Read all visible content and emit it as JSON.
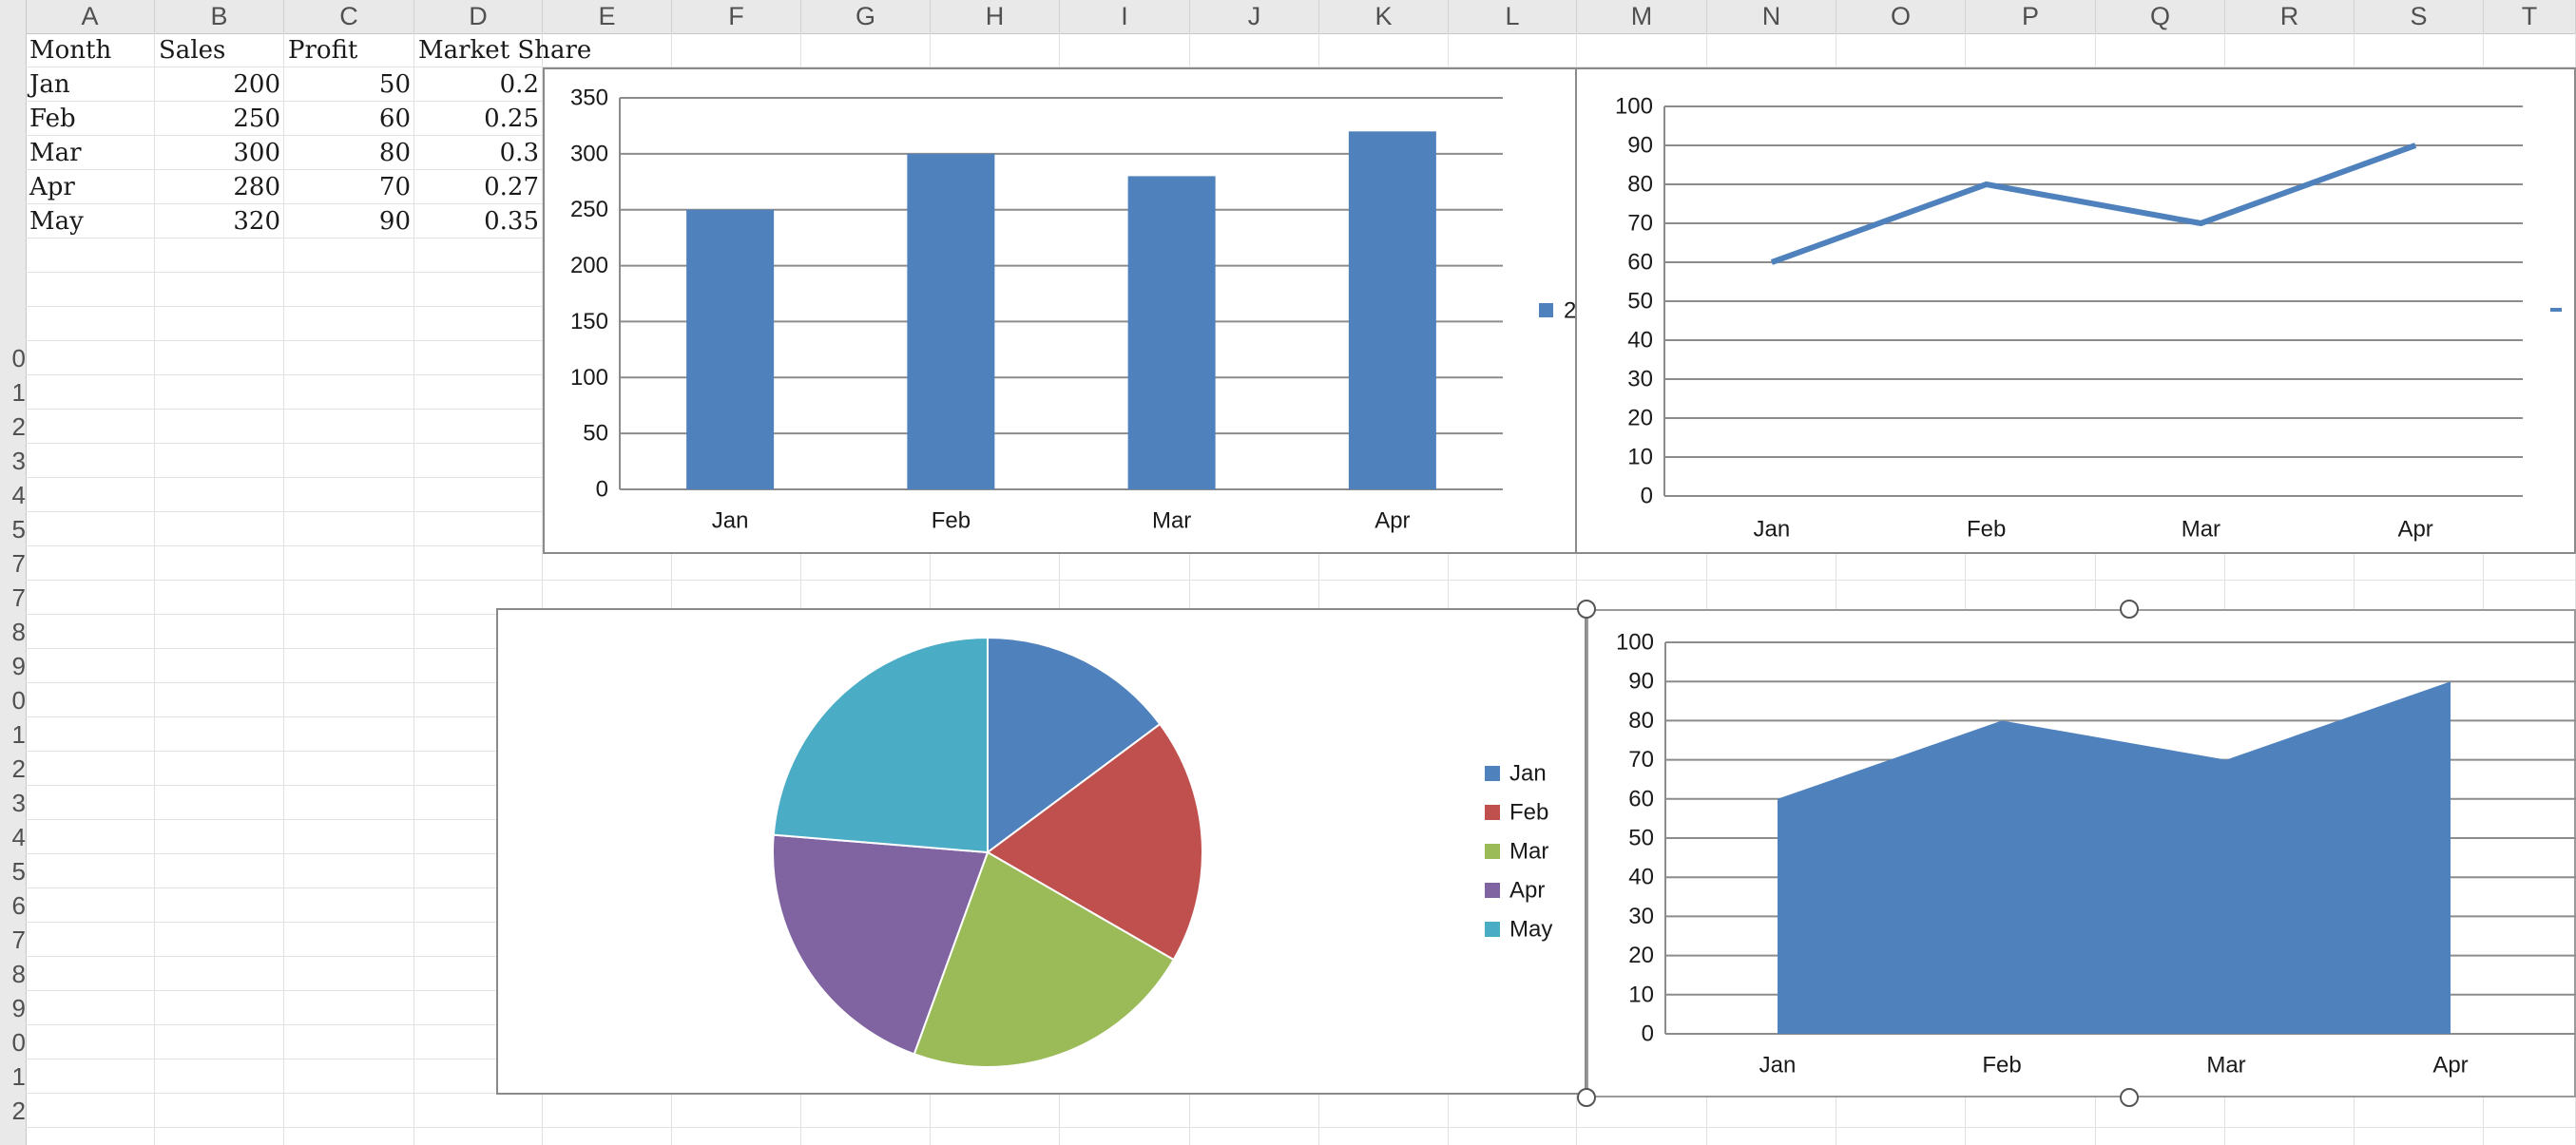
{
  "columns": [
    "A",
    "B",
    "C",
    "D",
    "E",
    "F",
    "G",
    "H",
    "I",
    "J",
    "K",
    "L",
    "M",
    "N",
    "O",
    "P",
    "Q",
    "R",
    "S",
    "T"
  ],
  "rows": [
    "",
    "",
    "",
    "",
    "",
    "",
    "",
    "",
    "",
    "0",
    "1",
    "2",
    "3",
    "4",
    "5",
    "7",
    "7",
    "8",
    "9",
    "0",
    "1",
    "2",
    "3",
    "4",
    "5",
    "6",
    "7",
    "8",
    "9",
    "0",
    "1",
    "2"
  ],
  "table": {
    "header": [
      "Month",
      "Sales",
      "Profit",
      "Market Share"
    ],
    "rows": [
      [
        "Jan",
        "200",
        "50",
        "0.2"
      ],
      [
        "Feb",
        "250",
        "60",
        "0.25"
      ],
      [
        "Mar",
        "300",
        "80",
        "0.3"
      ],
      [
        "Apr",
        "280",
        "70",
        "0.27"
      ],
      [
        "May",
        "320",
        "90",
        "0.35"
      ]
    ]
  },
  "colors": {
    "blue": "#4f81bd",
    "red": "#c0504d",
    "green": "#9bbb59",
    "purple": "#8064a2",
    "teal": "#4bacc6",
    "grid": "#8c8c8c"
  },
  "chart_data": [
    {
      "type": "bar",
      "categories": [
        "Jan",
        "Feb",
        "Mar",
        "Apr"
      ],
      "series": [
        {
          "values": [
            250,
            300,
            280,
            320
          ]
        }
      ],
      "legend_text": "2",
      "ylim": [
        0,
        350
      ],
      "yticks": [
        0,
        50,
        100,
        150,
        200,
        250,
        300,
        350
      ],
      "grid": true,
      "legend": "right"
    },
    {
      "type": "line",
      "categories": [
        "Jan",
        "Feb",
        "Mar",
        "Apr"
      ],
      "series": [
        {
          "values": [
            60,
            80,
            70,
            90
          ]
        }
      ],
      "ylim": [
        0,
        100
      ],
      "yticks": [
        0,
        10,
        20,
        30,
        40,
        50,
        60,
        70,
        80,
        90,
        100
      ],
      "grid": true
    },
    {
      "type": "pie",
      "labels": [
        "Jan",
        "Feb",
        "Mar",
        "Apr",
        "May"
      ],
      "values": [
        200,
        250,
        300,
        280,
        320
      ],
      "legend": "right"
    },
    {
      "type": "area",
      "categories": [
        "Jan",
        "Feb",
        "Mar",
        "Apr"
      ],
      "series": [
        {
          "values": [
            60,
            80,
            70,
            90
          ]
        }
      ],
      "ylim": [
        0,
        100
      ],
      "yticks": [
        0,
        10,
        20,
        30,
        40,
        50,
        60,
        70,
        80,
        90,
        100
      ],
      "grid": true
    }
  ]
}
